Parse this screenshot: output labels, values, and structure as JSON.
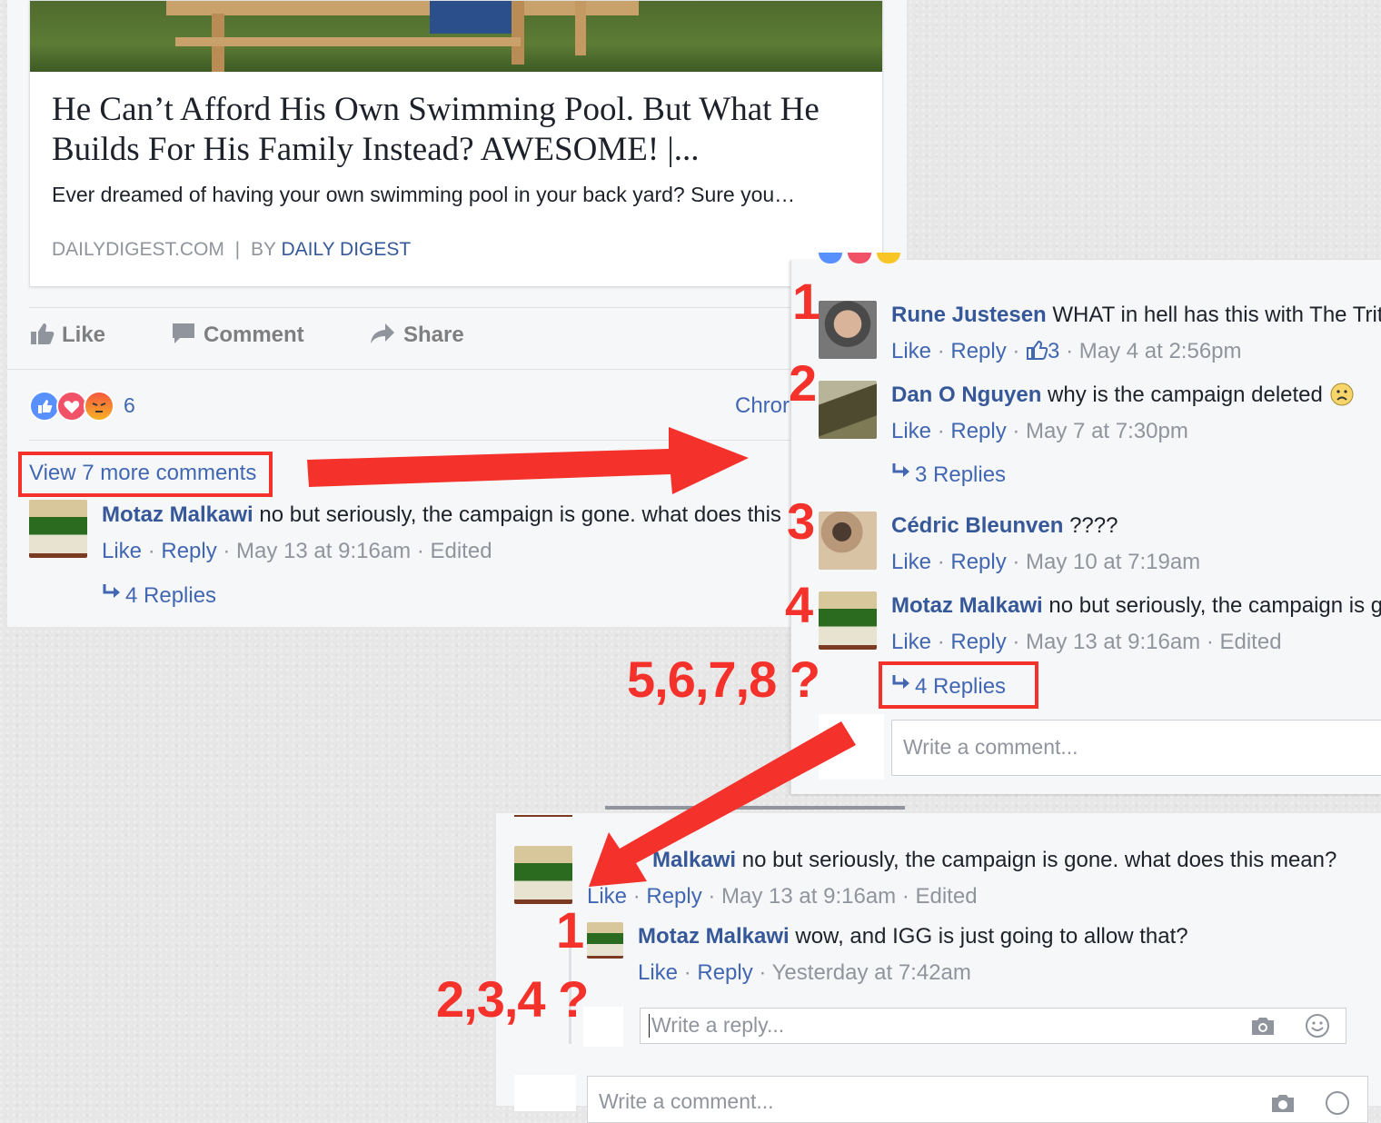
{
  "article": {
    "title": "He Can’t Afford His Own Swimming Pool. But What He Builds For His Family Instead? AWESOME! |...",
    "description": "Ever dreamed of having your own swimming pool in your back yard? Sure you…",
    "domain": "DAILYDIGEST.COM",
    "by_prefix": "BY",
    "author": "DAILY DIGEST"
  },
  "actions": {
    "like": "Like",
    "comment": "Comment",
    "share": "Share"
  },
  "reactions": {
    "count": "6",
    "truncated_text": "Chror"
  },
  "left_panel": {
    "view_more": "View 7 more comments",
    "comment": {
      "author": "Motaz Malkawi",
      "text": "no but seriously, the campaign is gone. what does this",
      "like": "Like",
      "reply": "Reply",
      "time": "May 13 at 9:16am",
      "edited": "Edited",
      "replies": "4 Replies"
    }
  },
  "right_panel": {
    "comments": [
      {
        "num": "1",
        "author": "Rune Justesen",
        "text": "WHAT in hell has this with The Trit",
        "like": "Like",
        "reply": "Reply",
        "likes": "3",
        "time": "May 4 at 2:56pm"
      },
      {
        "num": "2",
        "author": "Dan O Nguyen",
        "text": "why is the campaign deleted",
        "like": "Like",
        "reply": "Reply",
        "time": "May 7 at 7:30pm",
        "replies": "3 Replies"
      },
      {
        "num": "3",
        "author": "Cédric Bleunven",
        "text": "????",
        "like": "Like",
        "reply": "Reply",
        "time": "May 10 at 7:19am"
      },
      {
        "num": "4",
        "author": "Motaz Malkawi",
        "text": "no but seriously, the campaign is g",
        "like": "Like",
        "reply": "Reply",
        "time": "May 13 at 9:16am",
        "edited": "Edited",
        "replies": "4 Replies"
      }
    ],
    "write_placeholder": "Write a comment..."
  },
  "bottom_panel": {
    "comment": {
      "author_partial": "Malkawi",
      "text": "no but seriously, the campaign is gone. what does this mean?",
      "like": "Like",
      "reply": "Reply",
      "time": "May 13 at 9:16am",
      "edited": "Edited"
    },
    "reply": {
      "author": "Motaz Malkawi",
      "text": "wow, and IGG is just going to allow that?",
      "like": "Like",
      "reply": "Reply",
      "time": "Yesterday at 7:42am"
    },
    "reply_placeholder": "Write a reply...",
    "comment_placeholder": "Write a comment..."
  },
  "annotations": {
    "right_nums": [
      "1",
      "2",
      "3",
      "4"
    ],
    "missing_right": "5,6,7,8 ?",
    "bottom_num": "1",
    "missing_bottom": "2,3,4 ?"
  },
  "colors": {
    "link": "#365899",
    "annotation": "#f4312a",
    "meta": "#90949c",
    "like_blue": "#4267b2"
  }
}
